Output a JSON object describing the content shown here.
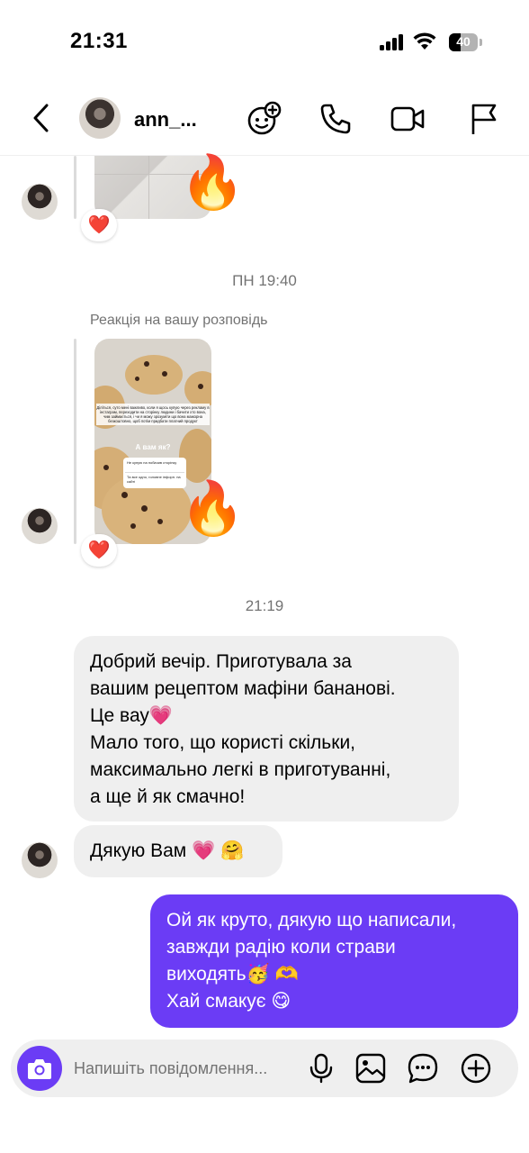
{
  "status_bar": {
    "time": "21:31",
    "battery": "40"
  },
  "header": {
    "username": "ann_...",
    "icons": [
      "back-chevron-icon",
      "avatar",
      "stickers-add-icon",
      "phone-icon",
      "video-camera-icon",
      "flag-icon"
    ]
  },
  "chat": {
    "timestamp_1": "ПН 19:40",
    "story_reply_label": "Реакція на вашу розповідь",
    "story_text": {
      "main": "Діліться, суто мені важливо, коли я щось купую через рекламу в інстаграм, переходити на сторінку людини і бачити хто вона, чим займається, і чи я можу зрозуміти що вона мажорна безкоштовно, щоб потім придбати платний продукт",
      "question": "А вам як?",
      "option_1": "Не купую на побачив сторінку",
      "option_2": "Та все одно, головне інфорн. на сайті"
    },
    "reaction_emoji": "🔥",
    "heart_reaction": "❤️",
    "timestamp_2": "21:19",
    "incoming_message_1": [
      "Добрий вечір. Приготувала за",
      "вашим рецептом мафіни бананові.",
      "Це вау💗",
      "Мало того, що користі скільки,",
      "максимально легкі в приготуванні,",
      "а ще й як смачно!"
    ],
    "incoming_message_2": "Дякую Вам 💗 🤗",
    "outgoing_message": [
      "Ой як круто, дякую що написали,",
      "завжди радію коли страви",
      "виходять🥳 🫶",
      "Хай смакує 😋"
    ]
  },
  "composer": {
    "placeholder": "Напишіть повідомлення...",
    "icons": [
      "camera-icon",
      "microphone-icon",
      "gallery-icon",
      "sticker-chat-icon",
      "plus-circle-icon"
    ]
  },
  "colors": {
    "accent": "#6b3cf5",
    "incoming_bubble": "#efefef",
    "muted_text": "#737373"
  }
}
